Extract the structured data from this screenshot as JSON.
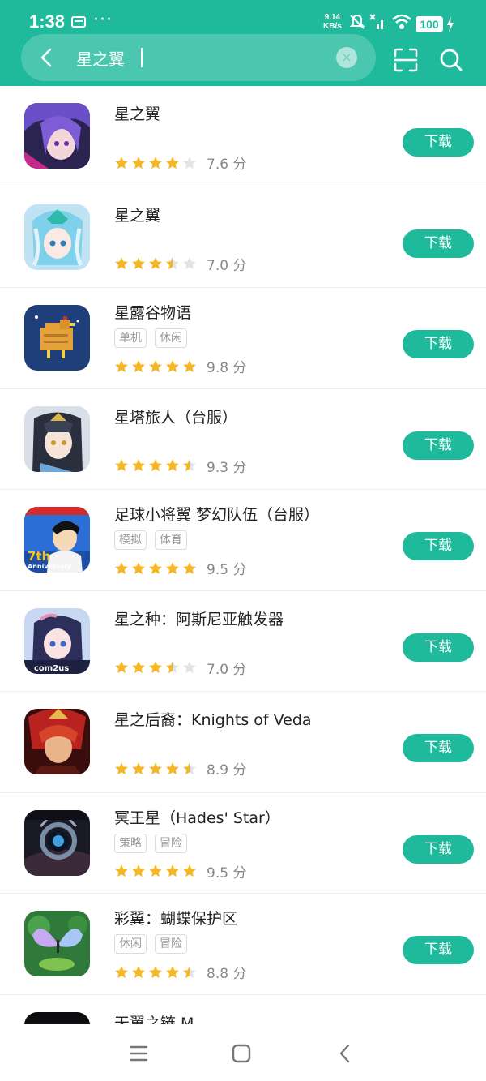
{
  "status_bar": {
    "time": "1:38",
    "speed_value": "9.14",
    "speed_unit": "KB/s",
    "battery": "100"
  },
  "search": {
    "query": "星之翼",
    "clear_symbol": "×"
  },
  "colors": {
    "accent": "#1fba9c",
    "star_on": "#f6b724",
    "star_off": "#e3e3e3"
  },
  "download_label": "下载",
  "apps": [
    {
      "name": "星之翼",
      "tags": [],
      "rating": 4,
      "score": "7.6 分",
      "icon": "purple-hair-anime-icon"
    },
    {
      "name": "星之翼",
      "tags": [],
      "rating": 3.5,
      "score": "7.0 分",
      "icon": "mecha-girl-anime-icon"
    },
    {
      "name": "星露谷物语",
      "tags": [
        "单机",
        "休闲"
      ],
      "rating": 5,
      "score": "9.8 分",
      "icon": "pixel-chicken-icon"
    },
    {
      "name": "星塔旅人（台服）",
      "tags": [],
      "rating": 4.5,
      "score": "9.3 分",
      "icon": "dark-hair-anime-icon"
    },
    {
      "name": "足球小将翼 梦幻队伍（台服）",
      "tags": [
        "模拟",
        "体育"
      ],
      "rating": 5,
      "score": "9.5 分",
      "icon": "soccer-anniversary-icon"
    },
    {
      "name": "星之种：阿斯尼亚触发器",
      "tags": [],
      "rating": 3.5,
      "score": "7.0 分",
      "icon": "com2us-anime-girl-icon"
    },
    {
      "name": "星之后裔：Knights of Veda",
      "tags": [],
      "rating": 4.5,
      "score": "8.9 分",
      "icon": "red-warrior-icon"
    },
    {
      "name": "冥王星（Hades' Star）",
      "tags": [
        "策略",
        "冒险"
      ],
      "rating": 5,
      "score": "9.5 分",
      "icon": "space-portal-icon"
    },
    {
      "name": "彩翼：蝴蝶保护区",
      "tags": [
        "休闲",
        "冒险"
      ],
      "rating": 4.5,
      "score": "8.8 分",
      "icon": "butterfly-icon"
    },
    {
      "name": "天翼之链 M",
      "tags": [],
      "rating": 0,
      "score": "",
      "icon": "dark-app-icon"
    }
  ]
}
